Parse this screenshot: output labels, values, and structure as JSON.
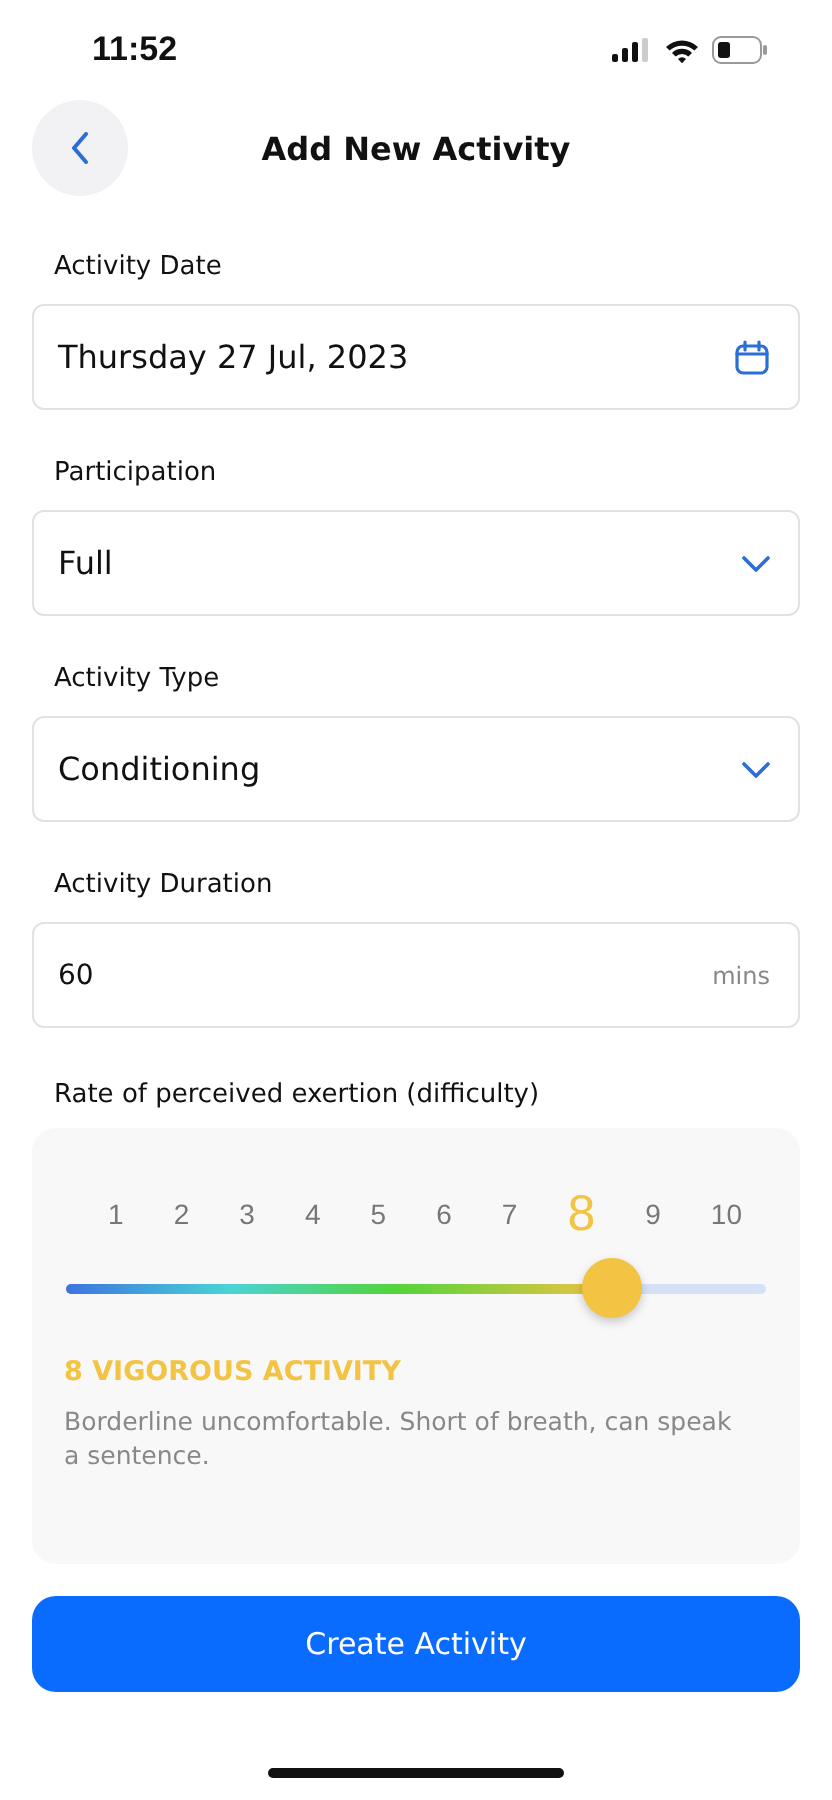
{
  "status_bar": {
    "time": "11:52"
  },
  "header": {
    "title": "Add New Activity"
  },
  "fields": [
    {
      "kind": "date",
      "label": "Activity Date",
      "value": "Thursday 27 Jul, 2023"
    },
    {
      "kind": "select",
      "label": "Participation",
      "value": "Full"
    },
    {
      "kind": "select",
      "label": "Activity Type",
      "value": "Conditioning"
    },
    {
      "kind": "number",
      "label": "Activity Duration",
      "value": "60",
      "unit": "mins"
    }
  ],
  "exertion": {
    "label": "Rate of perceived exertion (difficulty)",
    "scale": [
      {
        "label": "1",
        "selected": false
      },
      {
        "label": "2",
        "selected": false
      },
      {
        "label": "3",
        "selected": false
      },
      {
        "label": "4",
        "selected": false
      },
      {
        "label": "5",
        "selected": false
      },
      {
        "label": "6",
        "selected": false
      },
      {
        "label": "7",
        "selected": false
      },
      {
        "label": "8",
        "selected": true
      },
      {
        "label": "9",
        "selected": false
      },
      {
        "label": "10",
        "selected": false
      }
    ],
    "level": 0.78,
    "heading": "8 VIGOROUS ACTIVITY",
    "description": "Borderline uncomfortable. Short of breath, can speak a sentence."
  },
  "button": "Create Activity"
}
